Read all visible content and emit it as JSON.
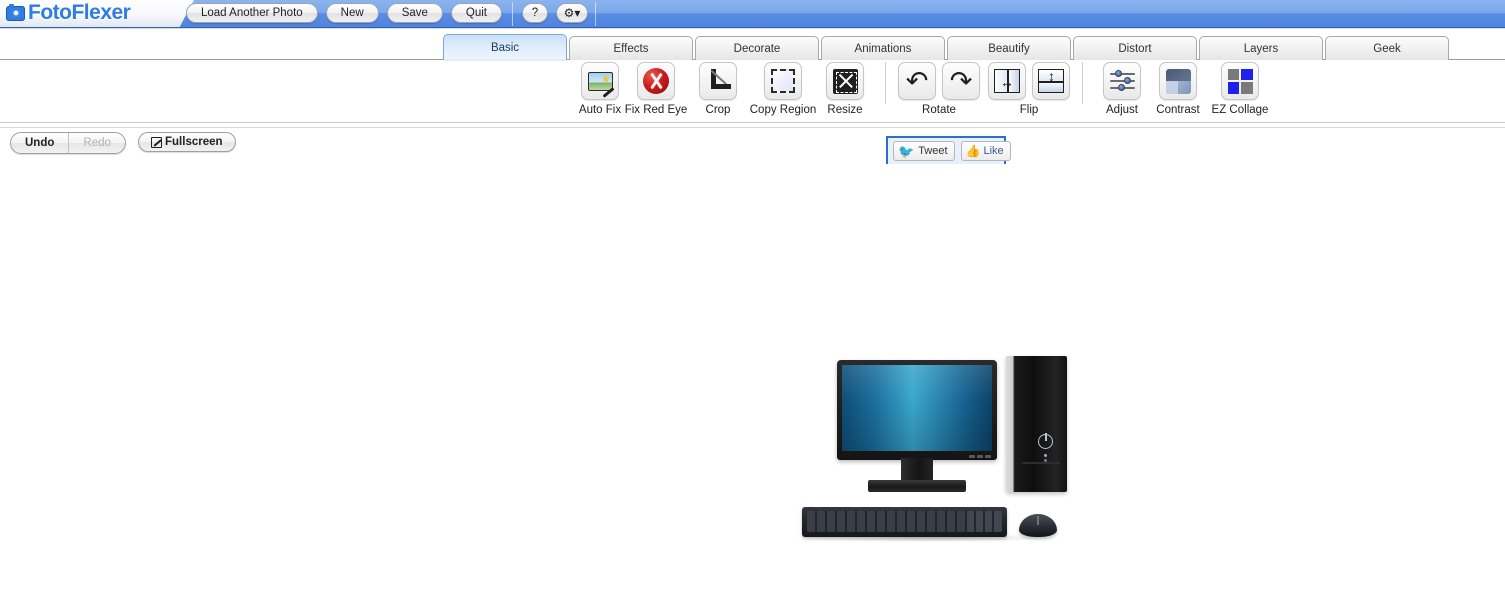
{
  "app": {
    "title": "FotoFlexer",
    "logo_icon": "camera-icon"
  },
  "header": {
    "buttons": [
      {
        "label": "Load Another Photo",
        "name": "load-another-photo-button"
      },
      {
        "label": "New",
        "name": "new-button"
      },
      {
        "label": "Save",
        "name": "save-button"
      },
      {
        "label": "Quit",
        "name": "quit-button"
      }
    ],
    "help_label": "?",
    "settings_label": "⚙▾"
  },
  "tabs": {
    "active": "Basic",
    "items": [
      {
        "label": "Basic"
      },
      {
        "label": "Effects"
      },
      {
        "label": "Decorate"
      },
      {
        "label": "Animations"
      },
      {
        "label": "Beautify"
      },
      {
        "label": "Distort"
      },
      {
        "label": "Layers"
      },
      {
        "label": "Geek"
      }
    ]
  },
  "toolbar": {
    "tools": [
      {
        "label": "Auto Fix",
        "icon": "auto-fix-icon"
      },
      {
        "label": "Fix Red Eye",
        "icon": "red-eye-icon"
      },
      {
        "label": "Crop",
        "icon": "crop-icon"
      },
      {
        "label": "Copy Region",
        "icon": "copy-region-icon"
      },
      {
        "label": "Resize",
        "icon": "resize-icon"
      }
    ],
    "rotate_label": "Rotate",
    "rotate_ccw_icon": "rotate-left-icon",
    "rotate_cw_icon": "rotate-right-icon",
    "flip_label": "Flip",
    "flip_h_icon": "flip-horizontal-icon",
    "flip_v_icon": "flip-vertical-icon",
    "adjust_label": "Adjust",
    "contrast_label": "Contrast",
    "collage_label": "EZ Collage",
    "collage_colors": [
      "#7a7a7a",
      "#2020ee",
      "#2020ee",
      "#7a7a7a"
    ]
  },
  "actions": {
    "undo_label": "Undo",
    "redo_label": "Redo",
    "fullscreen_label": "Fullscreen",
    "fullscreen_icon": "fullscreen-icon"
  },
  "social": {
    "tweet_label": "Tweet",
    "tweet_icon": "twitter-bird-icon",
    "like_label": "Like",
    "like_icon": "facebook-thumb-icon"
  },
  "canvas": {
    "image_alt": "desktop-computer-photo"
  },
  "colors": {
    "header_top": "#7aa8ec",
    "header_bottom": "#4f84df",
    "brand_blue": "#2f7de1",
    "active_tab": "#dfecfb",
    "social_border": "#2a6fd4"
  }
}
